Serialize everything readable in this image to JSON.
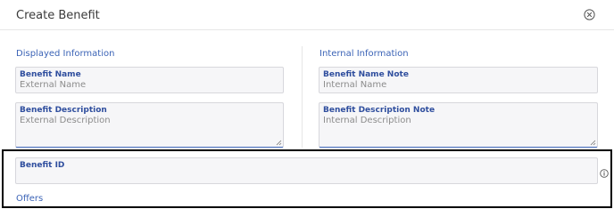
{
  "dialog": {
    "title": "Create Benefit",
    "close_icon": "close-circle-icon"
  },
  "displayed": {
    "heading": "Displayed Information",
    "benefit_name": {
      "label": "Benefit Name",
      "value": "",
      "placeholder": "External Name"
    },
    "benefit_description": {
      "label": "Benefit Description",
      "value": "",
      "placeholder": "External Description"
    }
  },
  "internal": {
    "heading": "Internal Information",
    "name_note": {
      "label": "Benefit Name Note",
      "value": "",
      "placeholder": "Internal Name"
    },
    "description_note": {
      "label": "Benefit Description Note",
      "value": "",
      "placeholder": "Internal Description"
    }
  },
  "benefit_id": {
    "label": "Benefit ID",
    "value": "",
    "info_icon": "info-icon"
  },
  "offers": {
    "heading": "Offers"
  },
  "colors": {
    "accent": "#3b63b6",
    "label": "#2f4e9e",
    "field_bg": "#f6f6f8",
    "highlight_border": "#000000"
  }
}
